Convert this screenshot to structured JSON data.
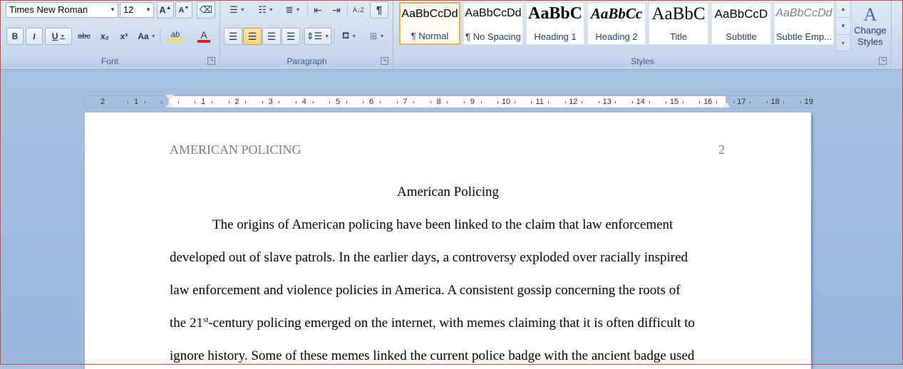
{
  "font_group": {
    "label": "Font",
    "font_name": "Times New Roman",
    "font_size": "12",
    "grow_icon": "grow-font-icon",
    "shrink_icon": "shrink-font-icon",
    "clear_icon": "clear-formatting-icon",
    "bold": "B",
    "italic": "I",
    "underline": "U",
    "strike": "abc",
    "subscript": "x₂",
    "superscript": "x²",
    "change_case": "Aa",
    "highlight": "ab",
    "font_color": "A",
    "highlight_color": "#f5e63a",
    "font_color_value": "#e21e1e"
  },
  "paragraph_group": {
    "label": "Paragraph",
    "pilcrow": "¶",
    "sort": "A↓Z"
  },
  "styles_group": {
    "label": "Styles",
    "tiles": [
      {
        "sample": "AaBbCcDd",
        "name": "¶ Normal"
      },
      {
        "sample": "AaBbCcDd",
        "name": "¶ No Spacing"
      },
      {
        "sample": "AaBbC",
        "name": "Heading 1"
      },
      {
        "sample": "AaBbCc",
        "name": "Heading 2"
      },
      {
        "sample": "AaBbC",
        "name": "Title"
      },
      {
        "sample": "AaBbCcD",
        "name": "Subtitle"
      },
      {
        "sample": "AaBbCcDd",
        "name": "Subtle Emp..."
      }
    ],
    "change_styles": "Change Styles"
  },
  "ruler": {
    "left_numbers": [
      "2",
      "1"
    ],
    "right_numbers": [
      "1",
      "2",
      "3",
      "4",
      "5",
      "6",
      "7",
      "8",
      "9",
      "10",
      "11",
      "12",
      "13",
      "14",
      "15",
      "16",
      "17",
      "18",
      "19"
    ]
  },
  "document": {
    "header_left": "AMERICAN POLICING",
    "header_right": "2",
    "title": "American Policing",
    "lines": [
      "The origins of American policing have been linked to the claim that law enforcement",
      "developed out of slave patrols. In the earlier days, a controversy exploded over racially inspired",
      "law enforcement and violence policies in America. A consistent gossip concerning the roots of",
      "the 21",
      "st",
      "-century policing emerged on the internet, with memes claiming that it is often difficult to",
      "ignore history. Some of these memes linked the current police badge with the ancient badge used"
    ]
  }
}
